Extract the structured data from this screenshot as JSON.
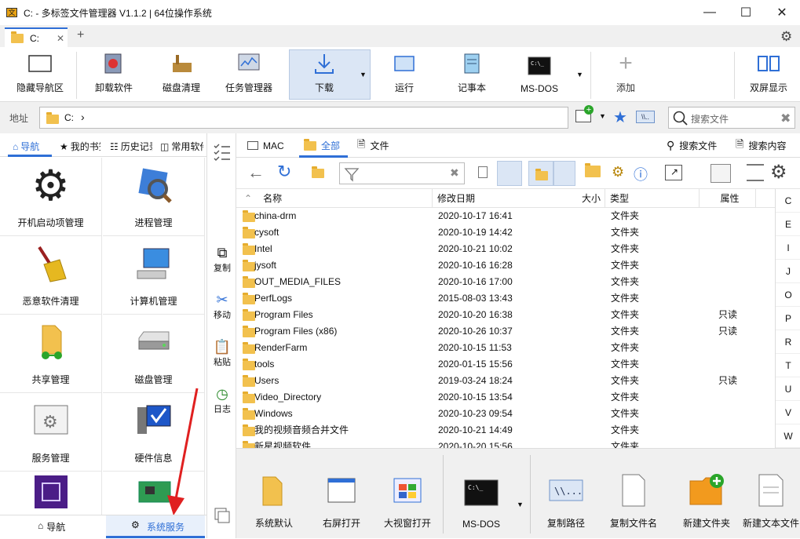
{
  "window": {
    "title": "C: - 多标签文件管理器 V1.1.2 | 64位操作系统",
    "app_icon_text": "文"
  },
  "tabs": [
    {
      "label": "C:"
    }
  ],
  "toolbar": [
    {
      "label": "隐藏导航区"
    },
    {
      "label": "卸载软件"
    },
    {
      "label": "磁盘清理"
    },
    {
      "label": "任务管理器"
    },
    {
      "label": "下载"
    },
    {
      "label": "运行"
    },
    {
      "label": "记事本"
    },
    {
      "label": "MS-DOS"
    },
    {
      "label": "添加"
    },
    {
      "label": "双屏显示"
    }
  ],
  "address": {
    "label": "地址",
    "path": "C:",
    "chevron": "›",
    "search_placeholder": "搜索文件"
  },
  "left_tabs": [
    {
      "label": "导航"
    },
    {
      "label": "我的书签"
    },
    {
      "label": "历史记录"
    },
    {
      "label": "常用软件"
    }
  ],
  "nav_items": [
    {
      "label": "开机启动项管理"
    },
    {
      "label": "进程管理"
    },
    {
      "label": "恶意软件清理"
    },
    {
      "label": "计算机管理"
    },
    {
      "label": "共享管理"
    },
    {
      "label": "磁盘管理"
    },
    {
      "label": "服务管理"
    },
    {
      "label": "硬件信息"
    }
  ],
  "left_footer": {
    "nav_label": "导航",
    "service_label": "系统服务"
  },
  "side_actions": [
    {
      "label": "复制"
    },
    {
      "label": "移动"
    },
    {
      "label": "粘贴"
    },
    {
      "label": "日志"
    }
  ],
  "right_tabs": [
    {
      "label": "MAC"
    },
    {
      "label": "全部"
    },
    {
      "label": "文件"
    },
    {
      "label": "搜索文件"
    },
    {
      "label": "搜索内容"
    }
  ],
  "columns": {
    "name": "名称",
    "modified": "修改日期",
    "size": "大小",
    "type": "类型",
    "attr": "属性"
  },
  "files": [
    {
      "name": "china-drm",
      "modified": "2020-10-17 16:41",
      "type": "文件夹",
      "attr": ""
    },
    {
      "name": "cysoft",
      "modified": "2020-10-19 14:42",
      "type": "文件夹",
      "attr": ""
    },
    {
      "name": "Intel",
      "modified": "2020-10-21 10:02",
      "type": "文件夹",
      "attr": ""
    },
    {
      "name": "jysoft",
      "modified": "2020-10-16 16:28",
      "type": "文件夹",
      "attr": ""
    },
    {
      "name": "OUT_MEDIA_FILES",
      "modified": "2020-10-16 17:00",
      "type": "文件夹",
      "attr": ""
    },
    {
      "name": "PerfLogs",
      "modified": "2015-08-03 13:43",
      "type": "文件夹",
      "attr": ""
    },
    {
      "name": "Program Files",
      "modified": "2020-10-20 16:38",
      "type": "文件夹",
      "attr": "只读"
    },
    {
      "name": "Program Files (x86)",
      "modified": "2020-10-26 10:37",
      "type": "文件夹",
      "attr": "只读"
    },
    {
      "name": "RenderFarm",
      "modified": "2020-10-15 11:53",
      "type": "文件夹",
      "attr": ""
    },
    {
      "name": "tools",
      "modified": "2020-01-15 15:56",
      "type": "文件夹",
      "attr": ""
    },
    {
      "name": "Users",
      "modified": "2019-03-24 18:24",
      "type": "文件夹",
      "attr": "只读"
    },
    {
      "name": "Video_Directory",
      "modified": "2020-10-15 13:54",
      "type": "文件夹",
      "attr": ""
    },
    {
      "name": "Windows",
      "modified": "2020-10-23 09:54",
      "type": "文件夹",
      "attr": ""
    },
    {
      "name": "我的视频音频合并文件",
      "modified": "2020-10-21 14:49",
      "type": "文件夹",
      "attr": ""
    },
    {
      "name": "新星视频软件",
      "modified": "2020-10-20 15:56",
      "type": "文件夹",
      "attr": ""
    }
  ],
  "drives": [
    "C",
    "E",
    "I",
    "J",
    "O",
    "P",
    "R",
    "T",
    "U",
    "V",
    "W"
  ],
  "bottom_actions": [
    {
      "label": "系统默认"
    },
    {
      "label": "右屏打开"
    },
    {
      "label": "大视窗打开"
    },
    {
      "label": "MS-DOS"
    },
    {
      "label": "复制路径"
    },
    {
      "label": "复制文件名"
    },
    {
      "label": "新建文件夹"
    },
    {
      "label": "新建文本文件"
    }
  ],
  "colors": {
    "accent": "#2f6fd6",
    "folder": "#f2c14e",
    "arrow": "#e02020"
  }
}
